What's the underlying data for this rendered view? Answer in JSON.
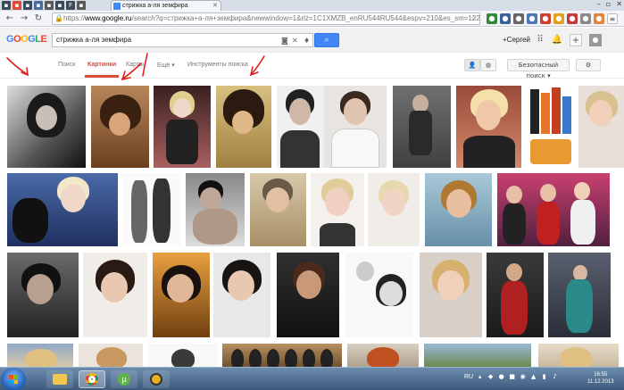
{
  "browser": {
    "tab_title": "стрижка а-ля земфира",
    "url_scheme": "https://",
    "url_host": "www.google.ru",
    "url_path": "/search?q=стрижка+а-ля+земфира&newwindow=1&rlz=1C1XMZB_enRU544RU544&espv=210&es_sm=122&",
    "pinned_tab_letter": "F"
  },
  "google": {
    "logo": [
      "G",
      "O",
      "O",
      "G",
      "L",
      "E"
    ],
    "query": "стрижка а-ля земфира",
    "user": "+Сергей"
  },
  "search_tabs": [
    {
      "label": "Поиск",
      "active": false
    },
    {
      "label": "Картинки",
      "active": true
    },
    {
      "label": "Карты",
      "active": false
    },
    {
      "label": "Ещё ▾",
      "active": false
    },
    {
      "label": "Инструменты поиска",
      "active": false
    }
  ],
  "safe_search": "Безопасный поиск ▾",
  "colors": {
    "accent_red": "#dd4b39",
    "google_blue": "#4285f4",
    "arrow_red": "#e02020"
  },
  "icons": {
    "camera": "camera-icon",
    "microphone": "microphone-icon",
    "search": "search-icon",
    "apps": "apps-grid-icon",
    "bell": "bell-icon",
    "share": "share-plus-icon",
    "settings": "gear-icon"
  },
  "taskbar": {
    "lang": "RU",
    "time": "16:55",
    "date": "11.12.2013"
  }
}
